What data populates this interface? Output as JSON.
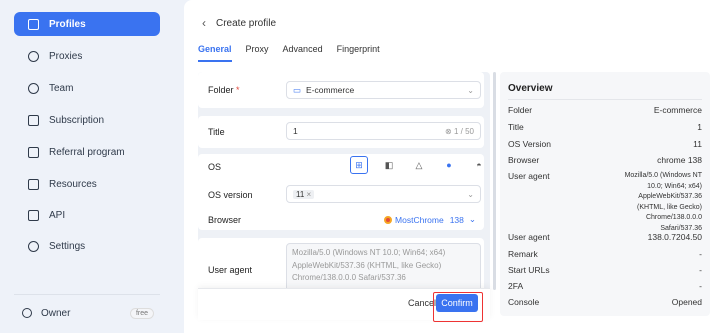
{
  "sidebar": {
    "items": [
      {
        "label": "Profiles",
        "icon": "calendar-icon"
      },
      {
        "label": "Proxies",
        "icon": "location-icon"
      },
      {
        "label": "Team",
        "icon": "users-icon"
      },
      {
        "label": "Subscription",
        "icon": "bookmark-icon"
      },
      {
        "label": "Referral program",
        "icon": "thumbs-up-icon"
      },
      {
        "label": "Resources",
        "icon": "cube-icon"
      },
      {
        "label": "API",
        "icon": "api-icon"
      },
      {
        "label": "Settings",
        "icon": "gear-icon"
      }
    ],
    "owner": {
      "label": "Owner",
      "badge": "free"
    }
  },
  "header": {
    "back": "‹",
    "title": "Create profile"
  },
  "tabs": [
    "General",
    "Proxy",
    "Advanced",
    "Fingerprint"
  ],
  "form": {
    "folder": {
      "label": "Folder",
      "required": "*",
      "value": "E-commerce"
    },
    "title": {
      "label": "Title",
      "value": "1",
      "counter": "1 / 50"
    },
    "os": {
      "label": "OS",
      "options": [
        "Windows",
        "macOS-M",
        "Linux",
        "Apple",
        "Android"
      ],
      "selected": "Windows"
    },
    "os_version": {
      "label": "OS version",
      "tag": "11",
      "tag_remove": "×"
    },
    "browser": {
      "label": "Browser",
      "name": "MostChrome",
      "version": "138"
    },
    "user_agent": {
      "label": "User agent",
      "lines": [
        "Mozilla/5.0 (Windows NT 10.0; Win64; x64)",
        "AppleWebKit/537.36 (KHTML, like Gecko)",
        "Chrome/138.0.0.0 Safari/537.36"
      ]
    }
  },
  "footer": {
    "cancel": "Cancel",
    "confirm": "Confirm"
  },
  "overview": {
    "title": "Overview",
    "rows": [
      {
        "k": "Folder",
        "v": "E-commerce"
      },
      {
        "k": "Title",
        "v": "1"
      },
      {
        "k": "OS Version",
        "v": "11"
      },
      {
        "k": "Browser",
        "v": "chrome  138"
      }
    ],
    "user_agent_label": "User agent",
    "user_agent_lines": [
      "Mozilla/5.0 (Windows NT",
      "10.0; Win64; x64)",
      "AppleWebKit/537.36",
      "(KHTML, like Gecko)",
      "Chrome/138.0.0.0",
      "Safari/537.36"
    ],
    "rows2": [
      {
        "k": "User agent",
        "v": "138.0.7204.50"
      },
      {
        "k": "Remark",
        "v": "-"
      },
      {
        "k": "Start URLs",
        "v": "-"
      },
      {
        "k": "2FA",
        "v": "-"
      },
      {
        "k": "Console",
        "v": "Opened"
      }
    ]
  },
  "colors": {
    "accent": "#3a73f0",
    "highlight": "#e33"
  }
}
